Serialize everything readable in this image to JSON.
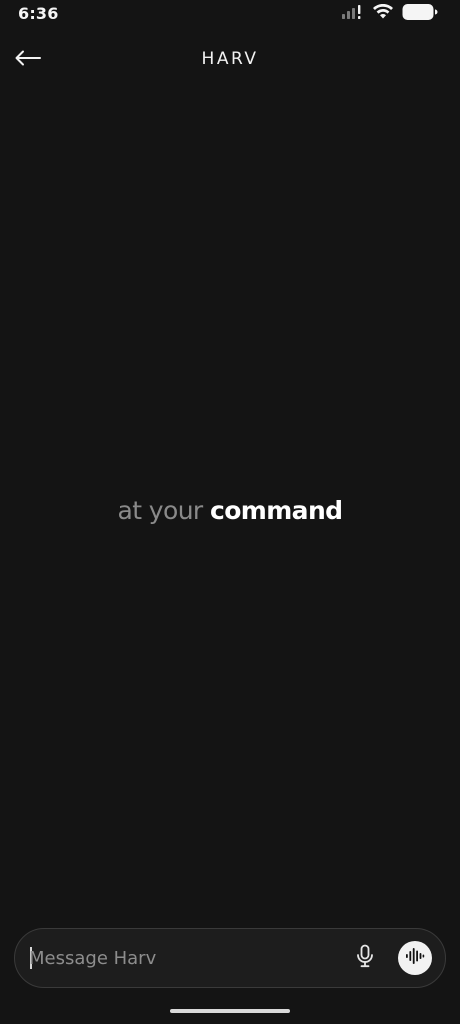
{
  "status_bar": {
    "time": "6:36",
    "icons": [
      "cellular-signal-icon",
      "wifi-icon",
      "battery-icon"
    ]
  },
  "header": {
    "title": "HARV",
    "back_icon": "arrow-left-icon"
  },
  "tagline": {
    "muted": "at your",
    "strong": "command"
  },
  "composer": {
    "placeholder": "Message Harv",
    "value": "",
    "mic_icon": "microphone-icon",
    "voice_icon": "voice-waveform-icon"
  },
  "colors": {
    "background": "#141414",
    "text_primary": "#ffffff",
    "text_muted": "#8a8a8a",
    "input_bg": "#1d1d1d",
    "input_border": "#3a3a3a",
    "voice_button_bg": "#f2f2f2"
  }
}
